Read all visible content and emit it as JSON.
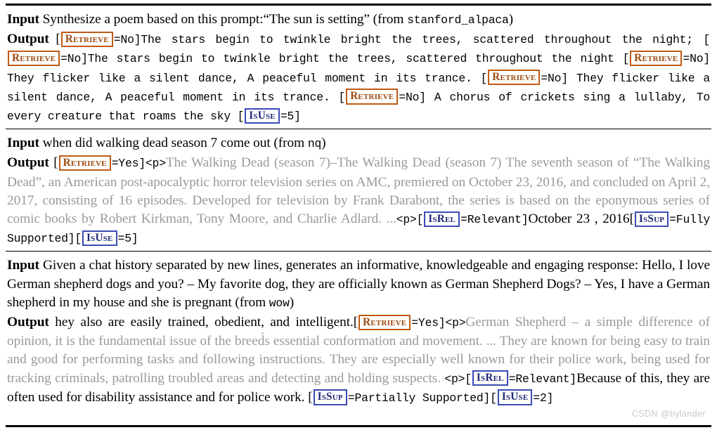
{
  "figure": {
    "watermark": "CSDN @bylander",
    "colors": {
      "retrieve_tag_border": "#c05a14",
      "retrieve_tag_text": "#9c4a10",
      "critique_tag_border": "#3b4bb5",
      "critique_tag_text": "#1f2a78",
      "retrieved_passage_text": "#9a9a9e",
      "body_text": "#000000"
    },
    "labels": {
      "input": "Input",
      "output": "Output"
    }
  },
  "examples": [
    {
      "id": "example-1",
      "dataset": "stanford_alpaca",
      "input": {
        "prefix": "Synthesize a poem based on this prompt:“The sun is setting” (from ",
        "suffix": ")"
      },
      "output": {
        "seg1_open": "[",
        "tag1": "Retrieve",
        "seg2": "=No]The stars begin to twinkle bright the trees, scattered throughout the night; [",
        "tag2": "Retrieve",
        "seg3": "=No]The stars begin to twinkle bright the trees, scattered throughout the night [",
        "tag3": "Retrieve",
        "seg4": "=No] They flicker like a silent dance, A peaceful moment in its trance. [",
        "tag4": "Retrieve",
        "seg5": "=No] They flicker like a silent dance, A peaceful moment in its trance. [",
        "tag5": "Retrieve",
        "seg6": "=No] A chorus of crickets sing a lullaby, To every creature that roams the sky [",
        "tag6": "IsUse",
        "seg7": "=5]"
      }
    },
    {
      "id": "example-2",
      "dataset": "nq",
      "input": {
        "prefix": "when did walking dead season 7 come out (from ",
        "suffix": ")"
      },
      "output": {
        "seg1_open": "[",
        "tag1": "Retrieve",
        "seg2_mono": "=Yes]<p>",
        "passage": "The Walking Dead (season 7)–The Walking Dead (season 7) The seventh season of “The Walking Dead”, an American post-apocalyptic horror television series on AMC, premiered on October 23, 2016, and concluded on April 2, 2017, consisting of 16 episodes. Developed for television by Frank Darabont, the series is based on the eponymous series of comic books by Robert Kirkman, Tony Moore, and Charlie Adlard. ...",
        "seg3_mono": "<p>[",
        "tag2": "IsRel",
        "seg4_mono": "=Relevant]",
        "answer": "October 23 , 2016",
        "seg5_open": "[",
        "tag3": "IsSup",
        "seg6_mono": "=Fully Supported][",
        "tag4": "IsUse",
        "seg7": "=5]"
      }
    },
    {
      "id": "example-3",
      "dataset": "wow",
      "input": {
        "prefix": "Given a chat history separated by new lines, generates an informative, knowledgeable and engaging response: Hello, I love German shepherd dogs and you? – My favorite dog, they are officially known as German Shepherd Dogs? – Yes, I have a German shepherd in my house and she is pregnant (from ",
        "suffix": ")"
      },
      "output": {
        "lead": "hey also are easily trained, obedient, and intelligent.[",
        "tag1": "Retrieve",
        "seg2_mono": "=Yes]<p>",
        "passage": "German Shepherd – a simple difference of opinion, it is the fundamental issue of the breed́s essential conformation and movement. ... They are known for being easy to train and good for performing tasks and following instructions. They are especially well known for their police work, being used for tracking criminals, patrolling troubled areas and detecting and holding suspects. ",
        "seg3_mono": "<p>[",
        "tag2": "IsRel",
        "seg4_mono": "=Relevant]",
        "answer": "Because of this, they are often used for disability assistance and for police work. [",
        "tag3": "IsSup",
        "seg5_mono": "=Partially Supported][",
        "tag4": "IsUse",
        "seg6": "=2]"
      }
    }
  ]
}
